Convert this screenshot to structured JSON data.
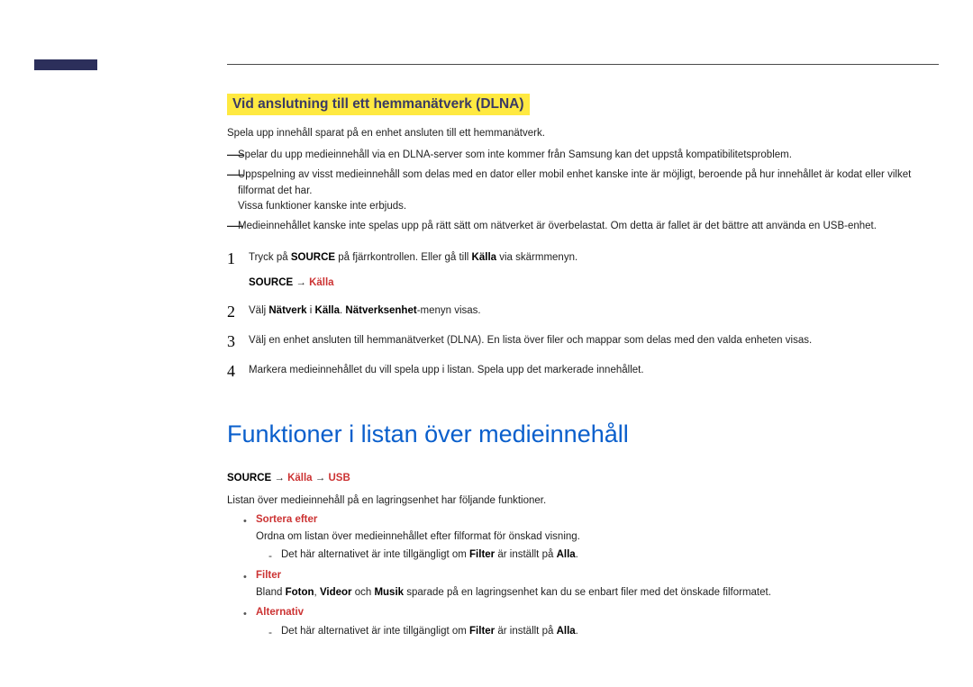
{
  "section_title": "Vid anslutning till ett hemmanätverk (DLNA)",
  "intro": "Spela upp innehåll sparat på en enhet ansluten till ett hemmanätverk.",
  "dashnotes": {
    "n1": "Spelar du upp medieinnehåll via en DLNA-server som inte kommer från Samsung kan det uppstå kompatibilitetsproblem.",
    "n2a": "Uppspelning av visst medieinnehåll som delas med en dator eller mobil enhet kanske inte är möjligt, beroende på hur innehållet är kodat eller vilket filformat det har.",
    "n2b": "Vissa funktioner kanske inte erbjuds.",
    "n3": "Medieinnehållet kanske inte spelas upp på rätt sätt om nätverket är överbelastat. Om detta är fallet är det bättre att använda en USB-enhet."
  },
  "steps": {
    "s1": {
      "num": "1",
      "text_a": "Tryck på ",
      "source": "SOURCE",
      "text_b": " på fjärrkontrollen. Eller gå till ",
      "kalla": "Källa",
      "text_c": " via skärmmenyn.",
      "path_source": "SOURCE",
      "path_arrow": " → ",
      "path_kalla": "Källa"
    },
    "s2": {
      "num": "2",
      "text_a": "Välj ",
      "natverk": "Nätverk",
      "text_b": " i ",
      "kalla": "Källa",
      "text_c": ". ",
      "natvenhet": "Nätverksenhet",
      "text_d": "-menyn visas."
    },
    "s3": {
      "num": "3",
      "text": "Välj en enhet ansluten till hemmanätverket (DLNA). En lista över filer och mappar som delas med den valda enheten visas."
    },
    "s4": {
      "num": "4",
      "text": "Markera medieinnehållet du vill spela upp i listan. Spela upp det markerade innehållet."
    }
  },
  "main_heading": "Funktioner i listan över medieinnehåll",
  "source_path": {
    "p1": "SOURCE",
    "arr": " → ",
    "p2": "Källa",
    "p3": "USB"
  },
  "main_intro": "Listan över medieinnehåll på en lagringsenhet har följande funktioner.",
  "bullets": {
    "b1": {
      "title": "Sortera efter",
      "desc": "Ordna om listan över medieinnehållet efter filformat för önskad visning.",
      "note_a": "Det här alternativet är inte tillgängligt om ",
      "filter": "Filter",
      "note_b": " är inställt på ",
      "alla": "Alla",
      "note_c": "."
    },
    "b2": {
      "title": "Filter",
      "desc_a": "Bland ",
      "foton": "Foton",
      "comma1": ", ",
      "videor": "Videor",
      "desc_b": " och ",
      "musik": "Musik",
      "desc_c": " sparade på en lagringsenhet kan du se enbart filer med det önskade filformatet."
    },
    "b3": {
      "title": "Alternativ",
      "note_a": "Det här alternativet är inte tillgängligt om ",
      "filter": "Filter",
      "note_b": " är inställt på ",
      "alla": "Alla",
      "note_c": "."
    }
  }
}
